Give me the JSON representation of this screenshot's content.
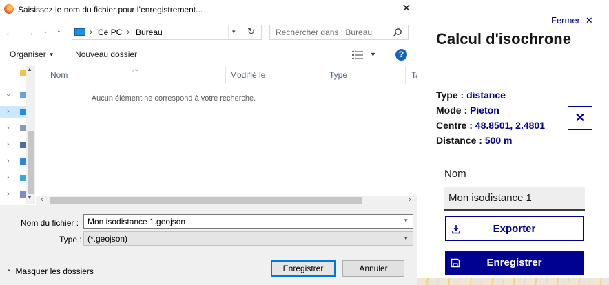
{
  "dialog": {
    "title": "Saisissez le nom du fichier pour l’enregistrement...",
    "close_glyph": "✕",
    "breadcrumb": [
      "Ce PC",
      "Bureau"
    ],
    "search_placeholder": "Rechercher dans : Bureau",
    "toolbar": {
      "organize": "Organiser",
      "new_folder": "Nouveau dossier",
      "help": "?"
    },
    "columns": [
      "Nom",
      "Modifié le",
      "Type",
      "Ta"
    ],
    "empty_message": "Aucun élément ne correspond à votre recherche.",
    "filename_label": "Nom du fichier :",
    "filename_value": "Mon isodistance 1.geojson",
    "type_label": "Type :",
    "type_value": "(*.geojson)",
    "hide_folders": "Masquer les dossiers",
    "save_button": "Enregistrer",
    "cancel_button": "Annuler"
  },
  "panel": {
    "close_label": "Fermer",
    "title": "Calcul d'isochrone",
    "info": [
      {
        "key": "Type :",
        "value": "distance"
      },
      {
        "key": "Mode :",
        "value": "Pieton"
      },
      {
        "key": "Centre :",
        "value": "48.8501, 2.4801"
      },
      {
        "key": "Distance :",
        "value": "500 m"
      }
    ],
    "name_label": "Nom",
    "name_value": "Mon isodistance 1",
    "export_button": "Exporter",
    "save_button": "Enregistrer"
  },
  "colors": {
    "accent": "#000091",
    "dialog_blue": "#0078d7",
    "help_blue": "#1565c0"
  },
  "icons": [
    "firefox-icon",
    "back-arrow-icon",
    "forward-arrow-icon",
    "up-arrow-icon",
    "computer-icon",
    "refresh-icon",
    "search-icon",
    "view-options-icon",
    "help-icon",
    "close-icon",
    "download-icon",
    "floppy-disk-icon"
  ]
}
